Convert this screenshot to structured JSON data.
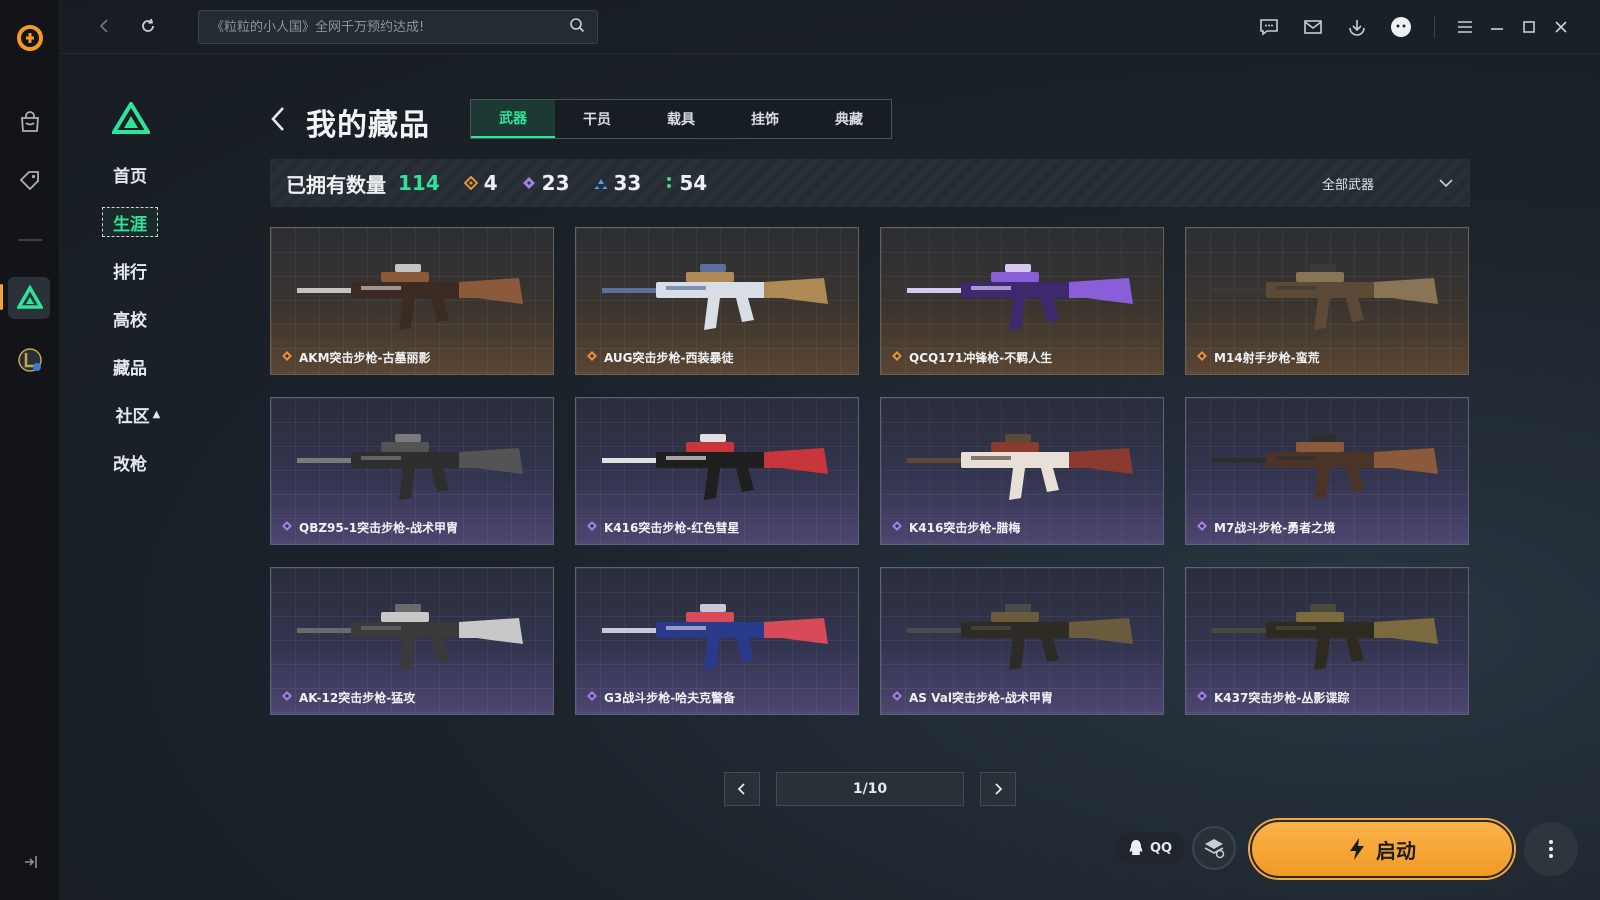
{
  "topbar": {
    "search_placeholder": "《粒粒的小人国》全网千万预约达成!"
  },
  "subnav": {
    "items": [
      {
        "label": "首页",
        "active": false
      },
      {
        "label": "生涯",
        "active": true
      },
      {
        "label": "排行",
        "active": false
      },
      {
        "label": "高校",
        "active": false
      },
      {
        "label": "藏品",
        "active": false
      },
      {
        "label": "社区",
        "active": false,
        "has_caret": true
      },
      {
        "label": "改枪",
        "active": false
      }
    ]
  },
  "page": {
    "title": "我的藏品"
  },
  "tabs": [
    {
      "label": "武器",
      "active": true
    },
    {
      "label": "干员",
      "active": false
    },
    {
      "label": "载具",
      "active": false
    },
    {
      "label": "挂饰",
      "active": false
    },
    {
      "label": "典藏",
      "active": false
    }
  ],
  "stats": {
    "owned_label": "已拥有数量",
    "owned_count": "114",
    "tiers": [
      {
        "icon": "gold-diamond-icon",
        "count": "4",
        "color": "#e6913a"
      },
      {
        "icon": "purple-diamond-icon",
        "count": "23",
        "color": "#a77ee6"
      },
      {
        "icon": "blue-tier-icon",
        "count": "33",
        "color": "#4aa3e8"
      },
      {
        "icon": "green-tier-icon",
        "count": "54",
        "color": "#3fd68c"
      }
    ],
    "filter_label": "全部武器"
  },
  "weapons": [
    {
      "name": "AKM突击步枪-古墓丽影",
      "rarity": "gold"
    },
    {
      "name": "AUG突击步枪-西装暴徒",
      "rarity": "gold"
    },
    {
      "name": "QCQ171冲锋枪-不羁人生",
      "rarity": "gold"
    },
    {
      "name": "M14射手步枪-蛮荒",
      "rarity": "gold"
    },
    {
      "name": "QBZ95-1突击步枪-战术甲胄",
      "rarity": "purple"
    },
    {
      "name": "K416突击步枪-红色彗星",
      "rarity": "purple"
    },
    {
      "name": "K416突击步枪-腊梅",
      "rarity": "purple"
    },
    {
      "name": "M7战斗步枪-勇者之境",
      "rarity": "purple"
    },
    {
      "name": "AK-12突击步枪-猛攻",
      "rarity": "purple"
    },
    {
      "name": "G3战斗步枪-哈夫克警备",
      "rarity": "purple"
    },
    {
      "name": "AS Val突击步枪-战术甲胄",
      "rarity": "purple"
    },
    {
      "name": "K437突击步枪-丛影谍踪",
      "rarity": "purple"
    }
  ],
  "pagination": {
    "current": 1,
    "total": 10,
    "display": "1/10"
  },
  "bottom": {
    "qq_label": "QQ",
    "launch_label": "启动"
  },
  "colors": {
    "accent_green": "#2fe39a",
    "launch_orange": "#f29a25",
    "gold_tier": "#e6913a",
    "purple_tier": "#a77ee6"
  }
}
